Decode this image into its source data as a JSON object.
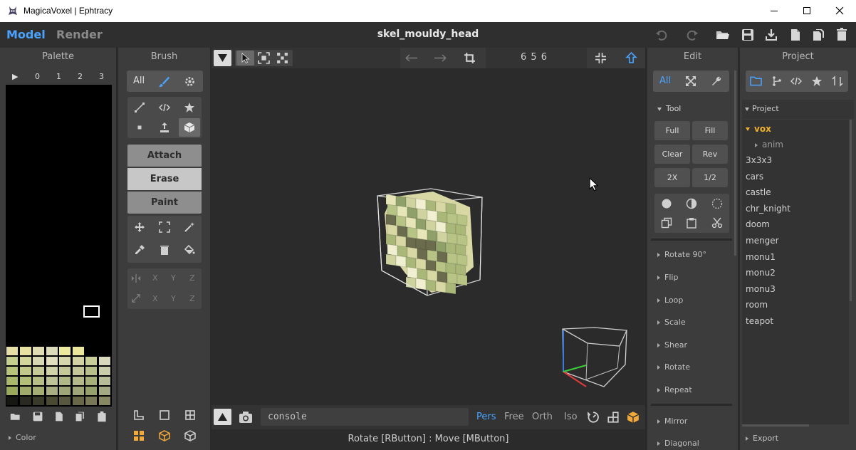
{
  "window": {
    "title": "MagicaVoxel | Ephtracy"
  },
  "header": {
    "mode_model": "Model",
    "mode_render": "Render",
    "file_title": "skel_mouldy_head"
  },
  "palette": {
    "title": "Palette",
    "play": "▶",
    "pages": [
      "0",
      "1",
      "2",
      "3"
    ],
    "footer_label": "Color",
    "swatch_rows": [
      [
        "#e6e0a6",
        "#e8e2a2",
        "#e0dcb4",
        "#dcdcba",
        "#ecea9e",
        "#eae79c"
      ],
      [
        "#c6d08e",
        "#d2d69c",
        "#d9d8b4",
        "#e1dfc0",
        "#d6d7ac",
        "#d3d2a6",
        "#c8cd9a",
        "#d8d9bc"
      ],
      [
        "#b8c47a",
        "#c3ca89",
        "#c7cb98",
        "#d1d3a8",
        "#c4c898",
        "#c5c79b",
        "#b8bf8b",
        "#c9cdaa"
      ],
      [
        "#a9b86a",
        "#b3bf77",
        "#b6bd86",
        "#bfc499",
        "#b1b888",
        "#b4b88b",
        "#a7b07b",
        "#b7bd96"
      ],
      [
        "#9aa95a",
        "#a0ab69",
        "#a3ad74",
        "#aaaf83",
        "#9ea677",
        "#a1a57a",
        "#96a06c",
        "#a4ab84"
      ],
      [
        "#161612",
        "#2a2a20",
        "#3a3a2a",
        "#4a4a32",
        "#585840",
        "#686848",
        "#787856",
        "#888862"
      ]
    ]
  },
  "brush": {
    "title": "Brush",
    "filter_all": "All",
    "attach": "Attach",
    "erase": "Erase",
    "paint": "Paint",
    "axes_mirror": [
      "X",
      "Y",
      "Z"
    ],
    "axes_scale": [
      "X",
      "Y",
      "Z"
    ]
  },
  "viewport": {
    "dims": "6  5  6",
    "console_placeholder": "console",
    "camera_modes": [
      "Pers",
      "Free",
      "Orth",
      "Iso"
    ],
    "status": "Rotate [RButton] : Move [MButton]",
    "voxel_colors": [
      "#e6e6b8",
      "#d8d8a4",
      "#cfd3a0",
      "#b7c486",
      "#a9b878",
      "#8fa06a",
      "#6b6b4e",
      "#f0efcf"
    ]
  },
  "edit": {
    "title": "Edit",
    "filter_all": "All",
    "tool_section": "Tool",
    "buttons": [
      "Full",
      "Fill",
      "Clear",
      "Rev",
      "2X",
      "1/2"
    ],
    "sections": [
      "Rotate 90°",
      "Flip",
      "Loop",
      "Scale",
      "Shear",
      "Rotate",
      "Repeat",
      "Mirror",
      "Diagonal"
    ]
  },
  "project": {
    "title": "Project",
    "section": "Project",
    "folder": "vox",
    "subfolder": "anim",
    "items": [
      "3x3x3",
      "cars",
      "castle",
      "chr_knight",
      "doom",
      "menger",
      "monu1",
      "monu2",
      "monu3",
      "room",
      "teapot"
    ],
    "export": "Export"
  },
  "colors": {
    "accent": "#4aa3ff",
    "orange": "#f2a93b",
    "folder": "#f0b030"
  }
}
